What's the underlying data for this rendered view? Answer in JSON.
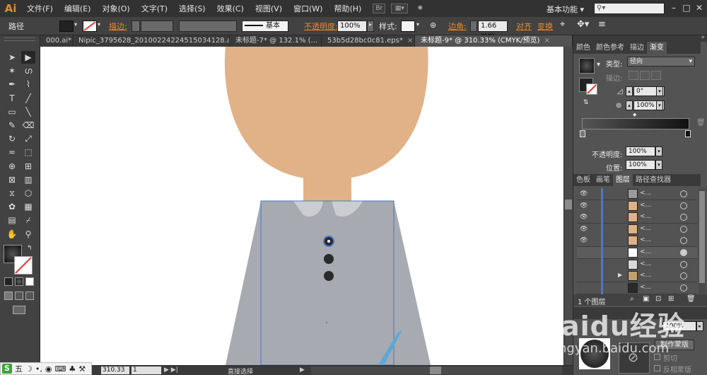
{
  "app": {
    "logo": "Ai",
    "bridge": "Br",
    "workspace": "基本功能"
  },
  "menu": [
    "文件(F)",
    "编辑(E)",
    "对象(O)",
    "文字(T)",
    "选择(S)",
    "效果(C)",
    "视图(V)",
    "窗口(W)",
    "帮助(H)"
  ],
  "window_controls": [
    "–",
    "□",
    "✕"
  ],
  "controlbar": {
    "selection_label": "路径",
    "stroke_label": "描边:",
    "stroke_style": "基本",
    "opacity_label": "不透明度:",
    "opacity_value": "100%",
    "style_label": "样式:",
    "corner_label": "边角:",
    "corner_value": "1.66 mm",
    "align_label": "对齐",
    "transform_label": "变换"
  },
  "tabs": [
    {
      "label": "000.ai*",
      "active": false
    },
    {
      "label": "Nipic_3795628_20100224224515034128.ai*",
      "active": false
    },
    {
      "label": "未标题-7* @ 132.1% (...",
      "active": false
    },
    {
      "label": "53b5d28bc0c81.eps*",
      "active": false
    },
    {
      "label": "未标题-9* @ 310.33% (CMYK/预览)",
      "active": true
    }
  ],
  "tools": [
    "selection-tool",
    "direct-selection-tool",
    "magic-wand-tool",
    "lasso-tool",
    "pen-tool",
    "curvature-tool",
    "type-tool",
    "line-tool",
    "rectangle-tool",
    "paintbrush-tool",
    "pencil-tool",
    "eraser-tool",
    "rotate-tool",
    "scale-tool",
    "width-tool",
    "free-transform-tool",
    "shape-builder-tool",
    "perspective-grid-tool",
    "mesh-tool",
    "gradient-tool",
    "eyedropper-tool",
    "blend-tool",
    "symbol-sprayer-tool",
    "column-graph-tool",
    "artboard-tool",
    "slice-tool",
    "hand-tool",
    "zoom-tool"
  ],
  "tool_glyphs": [
    "➤",
    "▶",
    "✶",
    "ഗ",
    "✒",
    "⌇",
    "T",
    "╱",
    "▭",
    "╲",
    "✎",
    "⌫",
    "↻",
    "⤢",
    "≈",
    "⬚",
    "⊕",
    "⊞",
    "⊠",
    "▥",
    "⧖",
    "⬡",
    "✿",
    "▦",
    "▤",
    "⌿",
    "✋",
    "⚲"
  ],
  "gradient_panel": {
    "tabs": [
      "颜色",
      "颜色参考",
      "描边",
      "渐变"
    ],
    "active_tab": "渐变",
    "type_label": "类型:",
    "type_value": "径向",
    "stroke_label": "描边:",
    "angle_value": "0°",
    "aspect_value": "100%",
    "opacity_label": "不透明度:",
    "opacity_value": "100%",
    "location_label": "位置:",
    "location_value": "100%"
  },
  "layers_panel": {
    "tabs": [
      "色板",
      "画笔",
      "图层",
      "路径查找器"
    ],
    "active_tab": "图层",
    "rows": [
      {
        "name": "<...",
        "eye": true,
        "thumb": "#9a9a9a"
      },
      {
        "name": "<...",
        "eye": true,
        "thumb": "#e0b088"
      },
      {
        "name": "<...",
        "eye": true,
        "thumb": "#e0b088"
      },
      {
        "name": "<...",
        "eye": true,
        "thumb": "#e0b088"
      },
      {
        "name": "<...",
        "eye": true,
        "thumb": "#e0b088"
      },
      {
        "name": "<...",
        "eye": false,
        "thumb": "#ffffff"
      },
      {
        "name": "<...",
        "eye": false,
        "thumb": "#d8d8d8"
      },
      {
        "name": "<...",
        "eye": false,
        "thumb": "#c0a070"
      },
      {
        "name": "<...",
        "eye": false,
        "thumb": "#2a2a2a"
      }
    ],
    "footer_count": "1 个图层"
  },
  "transparency_panel": {
    "opacity_value": "100%",
    "make_mask_button": "制作蒙版",
    "clip_label": "剪切",
    "invert_label": "反相蒙版"
  },
  "statusbar": {
    "zoom": "310.33",
    "page": "1",
    "current_tool": "直接选择"
  },
  "ime": {
    "logo": "S",
    "mode": "五"
  },
  "watermark": {
    "brand": "Baidu经验",
    "url": "jingyan.baidu.com"
  },
  "colors": {
    "skin": "#e1b287",
    "shirt": "#a7aab0",
    "collar": "#cbcdd1",
    "button": "#2a2a2a",
    "hair": "#6b4a2e",
    "selection_blue": "#4a78c2",
    "accent_orange": "#e8892b",
    "tie_blue": "#5aa9d8"
  }
}
